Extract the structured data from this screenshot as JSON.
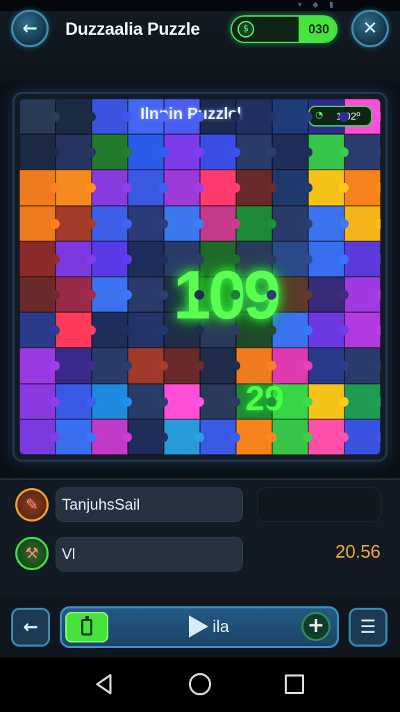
{
  "header": {
    "title": "Duzzaalia Puzzle",
    "score": "030",
    "back_icon": "arrow-left-icon",
    "close_icon": "close-icon"
  },
  "board": {
    "title": "Ilnnin Puzzlel",
    "timer": "1.02º",
    "big_number": "109",
    "small_number": "29",
    "colors": [
      [
        "#2a3a55",
        "#1b2b44",
        "#3b54e0",
        "#4466f0",
        "#4b5cf2",
        "#1c2a52",
        "#232f63",
        "#1f3b7a",
        "#2e2b8f",
        "#ff4fd8"
      ],
      [
        "#1d2a46",
        "#253360",
        "#1f7a2c",
        "#2b5be8",
        "#7b3be8",
        "#3a4ee6",
        "#2a3b6a",
        "#1e2d5a",
        "#37c44a",
        "#2a3c6e"
      ],
      [
        "#f07a1e",
        "#f58a1e",
        "#8a3be0",
        "#3a5ae6",
        "#9e3ad8",
        "#ff3a6e",
        "#6a2a2a",
        "#1e3a6a",
        "#f5c218",
        "#f5821a"
      ],
      [
        "#f07a1e",
        "#a33a2a",
        "#3e5fe8",
        "#2b3b7a",
        "#3a78f0",
        "#c43a8a",
        "#1e8a36",
        "#2a3b6a",
        "#3a72f0",
        "#f5b41a"
      ],
      [
        "#8a2a2a",
        "#7a3ae0",
        "#5a3ae6",
        "#1f2d5a",
        "#2a3a6a",
        "#1f6a2a",
        "#2a3a5a",
        "#2a4a8a",
        "#3a6ef0",
        "#5a3ad8"
      ],
      [
        "#6a2a2a",
        "#9a2a4a",
        "#3a72f0",
        "#2a3a6a",
        "#1f2d4a",
        "#1e7a32",
        "#2a3a6a",
        "#5a3a2a",
        "#3a2a7a",
        "#a03ae0"
      ],
      [
        "#2a3b8a",
        "#ff3a5a",
        "#1f2d5a",
        "#24336a",
        "#1f2d4a",
        "#2a3a5a",
        "#1f4a2a",
        "#3a72f0",
        "#6a3ae0",
        "#b03ae0"
      ],
      [
        "#9a3ae0",
        "#3a2a8a",
        "#2a3b6a",
        "#a03a2a",
        "#6a2a2a",
        "#1f2d4a",
        "#f07a1e",
        "#e03ab0",
        "#2a3a8a",
        "#2a3a6a"
      ],
      [
        "#8a3ae0",
        "#3a5ae6",
        "#1e8adf",
        "#2a3b6a",
        "#ff4fd8",
        "#2a3a5a",
        "#1e8a36",
        "#38d448",
        "#f5c218",
        "#1e9a52"
      ],
      [
        "#7a3ae0",
        "#3a6ef0",
        "#c43ac8",
        "#1f2d5a",
        "#2a9ad8",
        "#3a5ae6",
        "#f5821a",
        "#38c448",
        "#ff4fa8",
        "#3a52e0"
      ]
    ]
  },
  "panel": {
    "item1_label": "TanjuhsSail",
    "item1_icon": "wrench-icon",
    "item2_label": "Vl",
    "item2_icon": "tool-icon",
    "value": "20.56"
  },
  "toolbar": {
    "play_label": "ila",
    "back_icon": "arrow-left-icon",
    "menu_icon": "menu-icon",
    "battery_icon": "battery-icon",
    "plus_icon": "plus-icon"
  },
  "navbar": {
    "back_icon": "nav-back-icon",
    "home_icon": "nav-home-icon",
    "recents_icon": "nav-recents-icon"
  },
  "accent": {
    "green": "#45e33c",
    "blue": "#3a88b0",
    "orange": "#f2a93a"
  }
}
